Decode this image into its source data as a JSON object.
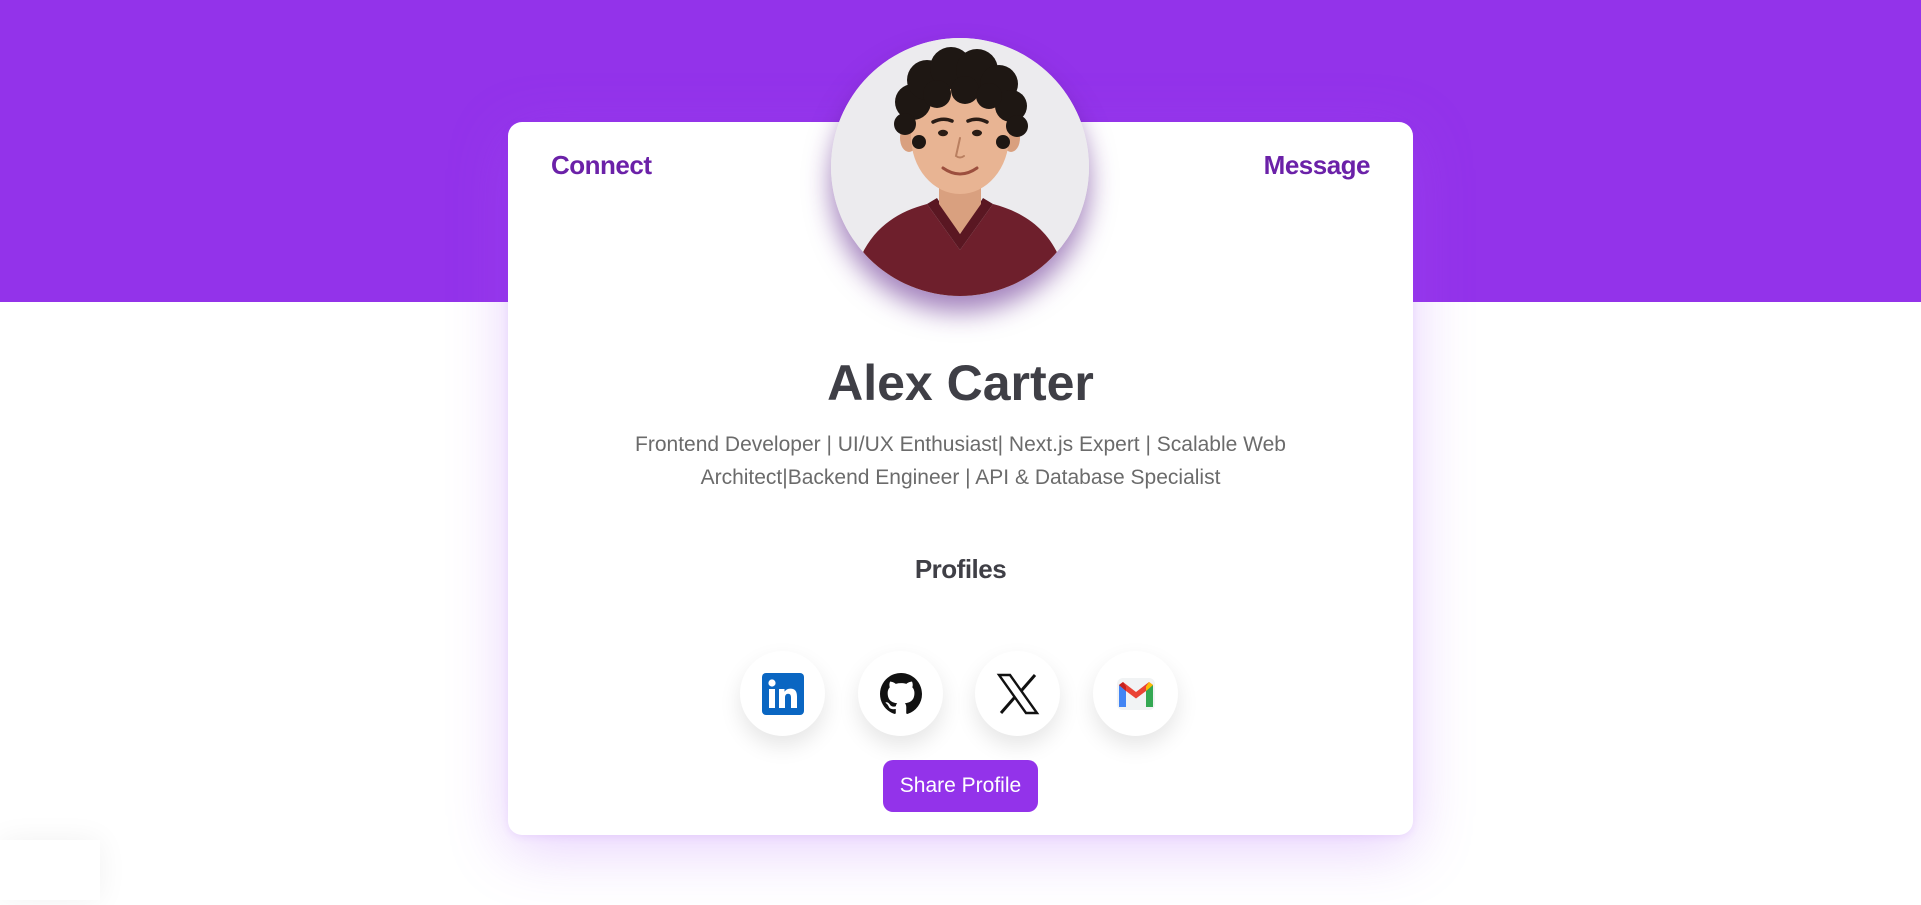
{
  "colors": {
    "banner": "#9333ea",
    "link": "#6b21a8",
    "heading": "#3f3f46",
    "body_text": "#6b6b6b",
    "button": "#9333ea"
  },
  "actions": {
    "connect_label": "Connect",
    "message_label": "Message"
  },
  "profile": {
    "name": "Alex Carter",
    "bio": "Frontend Developer | UI/UX Enthusiast| Next.js Expert | Scalable Web Architect|Backend Engineer | API & Database Specialist",
    "avatar_icon": "profile-photo"
  },
  "profiles_section": {
    "heading": "Profiles",
    "links": [
      {
        "icon": "linkedin-icon"
      },
      {
        "icon": "github-icon"
      },
      {
        "icon": "x-icon"
      },
      {
        "icon": "gmail-icon"
      }
    ]
  },
  "share": {
    "label": "Share Profile"
  }
}
